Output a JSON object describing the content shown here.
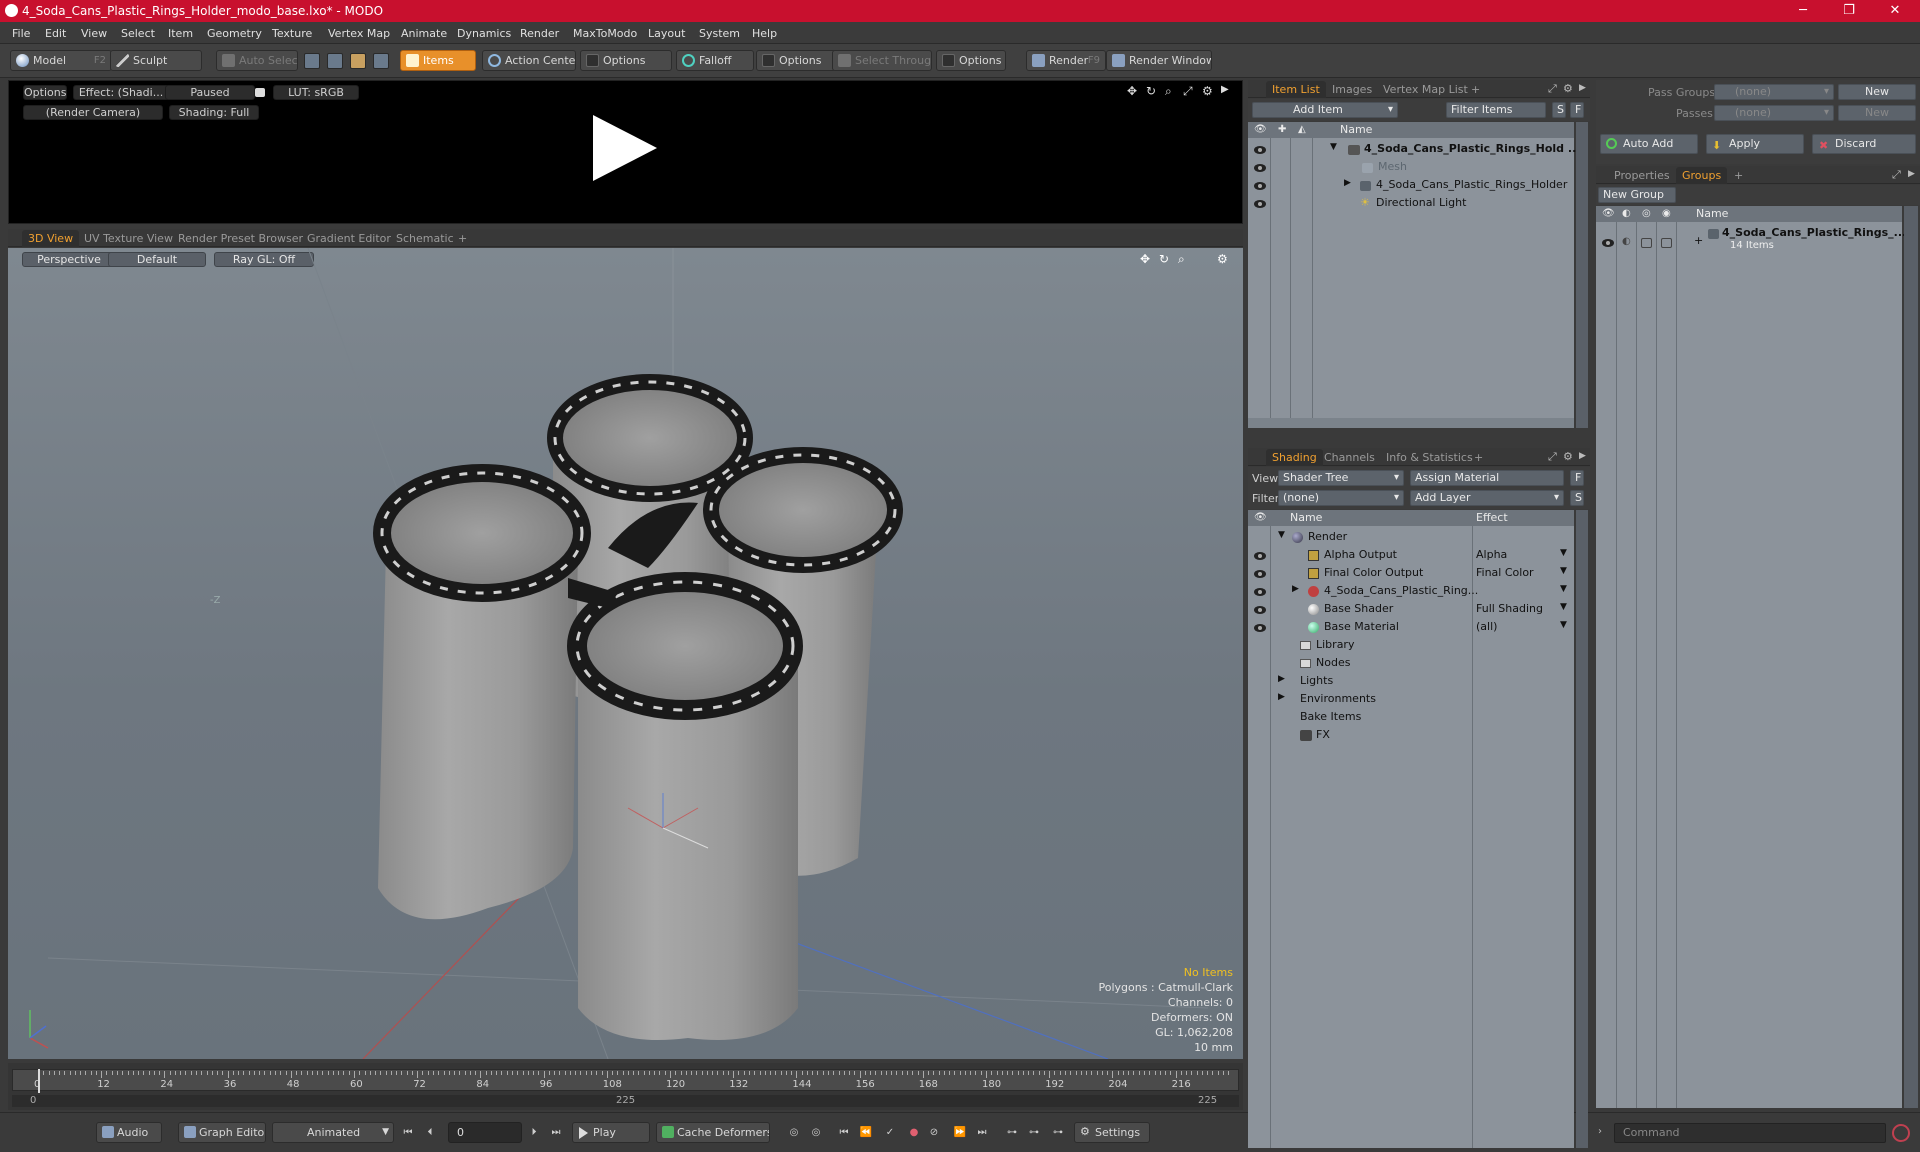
{
  "window": {
    "title": "4_Soda_Cans_Plastic_Rings_Holder_modo_base.lxo* - MODO",
    "minimize": "─",
    "maximize": "❐",
    "close": "✕"
  },
  "menu": [
    "File",
    "Edit",
    "View",
    "Select",
    "Item",
    "Geometry",
    "Texture",
    "Vertex Map",
    "Animate",
    "Dynamics",
    "Render",
    "MaxToModo",
    "Layout",
    "System",
    "Help"
  ],
  "toolbar": {
    "model": "Model",
    "model_key": "F2",
    "sculpt": "Sculpt",
    "auto_select": "Auto Select",
    "items": "Items",
    "action_center": "Action Center",
    "options1": "Options",
    "falloff": "Falloff",
    "options2": "Options",
    "select_through": "Select Through",
    "options3": "Options",
    "render": "Render",
    "render_key": "F9",
    "render_window": "Render Window"
  },
  "preview": {
    "options": "Options",
    "effect": "Effect: (Shadi...",
    "paused": "Paused",
    "lut": "LUT: sRGB",
    "camera": "(Render Camera)",
    "shading": "Shading: Full"
  },
  "viewport_tabs": [
    "3D View",
    "UV Texture View",
    "Render Preset Browser",
    "Gradient Editor",
    "Schematic",
    "+"
  ],
  "viewport": {
    "perspective": "Perspective",
    "default": "Default",
    "raygl": "Ray GL: Off",
    "axis_label": "-Z",
    "stats": {
      "items": "No Items",
      "polygons": "Polygons : Catmull-Clark",
      "channels": "Channels: 0",
      "deformers": "Deformers: ON",
      "gl": "GL: 1,062,208",
      "scale": "10 mm"
    }
  },
  "timeline": {
    "ticks": [
      "0",
      "12",
      "24",
      "36",
      "48",
      "60",
      "72",
      "84",
      "96",
      "108",
      "120",
      "132",
      "144",
      "156",
      "168",
      "180",
      "192",
      "204",
      "216"
    ],
    "start": "0",
    "mid": "225",
    "end": "225"
  },
  "bottombar": {
    "audio": "Audio",
    "graph_editor": "Graph Editor",
    "animated": "Animated",
    "frame": "0",
    "play": "Play",
    "cache_deformers": "Cache Deformers",
    "settings": "Settings",
    "command_placeholder": "Command"
  },
  "item_list": {
    "tabs": [
      "Item List",
      "Images",
      "Vertex Map List",
      "+"
    ],
    "add_item": "Add Item",
    "filter_items": "Filter Items",
    "s": "S",
    "f": "F",
    "col_name": "Name",
    "rows": [
      {
        "label": "4_Soda_Cans_Plastic_Rings_Hold ...",
        "bold": true
      },
      {
        "label": "Mesh",
        "dim": true
      },
      {
        "label": "4_Soda_Cans_Plastic_Rings_Holder"
      },
      {
        "label": "Directional Light"
      }
    ]
  },
  "shading": {
    "tabs": [
      "Shading",
      "Channels",
      "Info & Statistics",
      "+"
    ],
    "view_label": "View",
    "view_value": "Shader Tree",
    "assign_material": "Assign Material",
    "f": "F",
    "filter_label": "Filter",
    "filter_value": "(none)",
    "add_layer": "Add Layer",
    "s": "S",
    "col_name": "Name",
    "col_effect": "Effect",
    "rows": [
      {
        "label": "Render",
        "effect": ""
      },
      {
        "label": "Alpha Output",
        "effect": "Alpha"
      },
      {
        "label": "Final Color Output",
        "effect": "Final Color"
      },
      {
        "label": "4_Soda_Cans_Plastic_Ring...",
        "effect": ""
      },
      {
        "label": "Base Shader",
        "effect": "Full Shading"
      },
      {
        "label": "Base Material",
        "effect": "(all)"
      },
      {
        "label": "Library",
        "effect": ""
      },
      {
        "label": "Nodes",
        "effect": ""
      },
      {
        "label": "Lights",
        "effect": ""
      },
      {
        "label": "Environments",
        "effect": ""
      },
      {
        "label": "Bake Items",
        "effect": ""
      },
      {
        "label": "FX",
        "effect": ""
      }
    ]
  },
  "groups": {
    "pass_groups_label": "Pass Groups",
    "pass_groups_value": "(none)",
    "passes_label": "Passes",
    "passes_value": "(none)",
    "new1": "New",
    "new2": "New",
    "auto_add": "Auto Add",
    "apply": "Apply",
    "discard": "Discard",
    "tabs": [
      "Properties",
      "Groups",
      "+"
    ],
    "new_group": "New Group",
    "col_name": "Name",
    "group_name": "4_Soda_Cans_Plastic_Rings_...",
    "group_count": "14 Items"
  },
  "colors": {
    "title_bar": "#c8102e",
    "accent": "#e8902a",
    "panel_bg": "#8c939b"
  }
}
